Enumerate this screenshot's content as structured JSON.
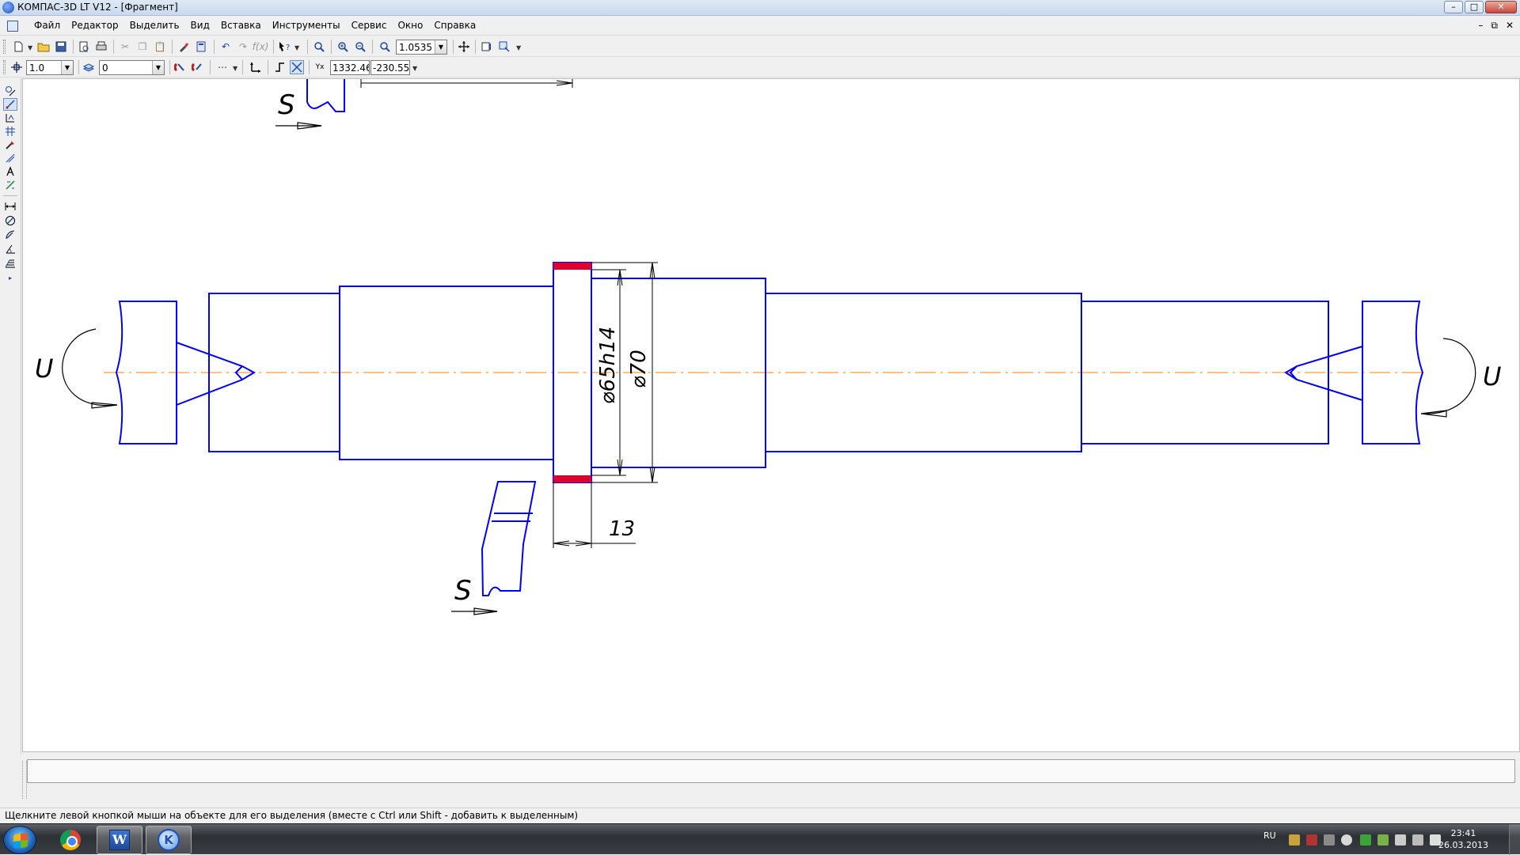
{
  "window": {
    "title": "КОМПАС-3D LT V12 - [Фрагмент]",
    "controls": {
      "minimize": "–",
      "maximize": "□",
      "close": "✕"
    }
  },
  "menu": {
    "items": [
      "Файл",
      "Редактор",
      "Выделить",
      "Вид",
      "Вставка",
      "Инструменты",
      "Сервис",
      "Окно",
      "Справка"
    ],
    "mdi_minimize": "–",
    "mdi_restore": "⧉",
    "mdi_close": "✕"
  },
  "toolbar": {
    "zoom_value": "1.0535"
  },
  "current_state": {
    "step_value": "1.0",
    "layer_value": "0",
    "coord_x": "1332.46",
    "coord_y": "-230.55"
  },
  "drawing": {
    "dimension_d1": "⌀65h14",
    "dimension_d2": "⌀70",
    "dimension_width": "13",
    "label_feed_top": "S",
    "label_feed_bottom": "S",
    "label_rotation_left": "U",
    "label_rotation_right": "U",
    "colors": {
      "contour": "#0000ff",
      "axis": "#ff8000",
      "highlight": "#e0002b",
      "dimension": "#000000"
    }
  },
  "status": {
    "message": "Щелкните левой кнопкой мыши на объекте для его выделения (вместе с Ctrl или Shift - добавить к выделенным)"
  },
  "taskbar": {
    "language": "RU",
    "time": "23:41",
    "date": "26.03.2013",
    "apps": [
      "chrome-icon",
      "word-icon",
      "kompas-icon"
    ]
  }
}
